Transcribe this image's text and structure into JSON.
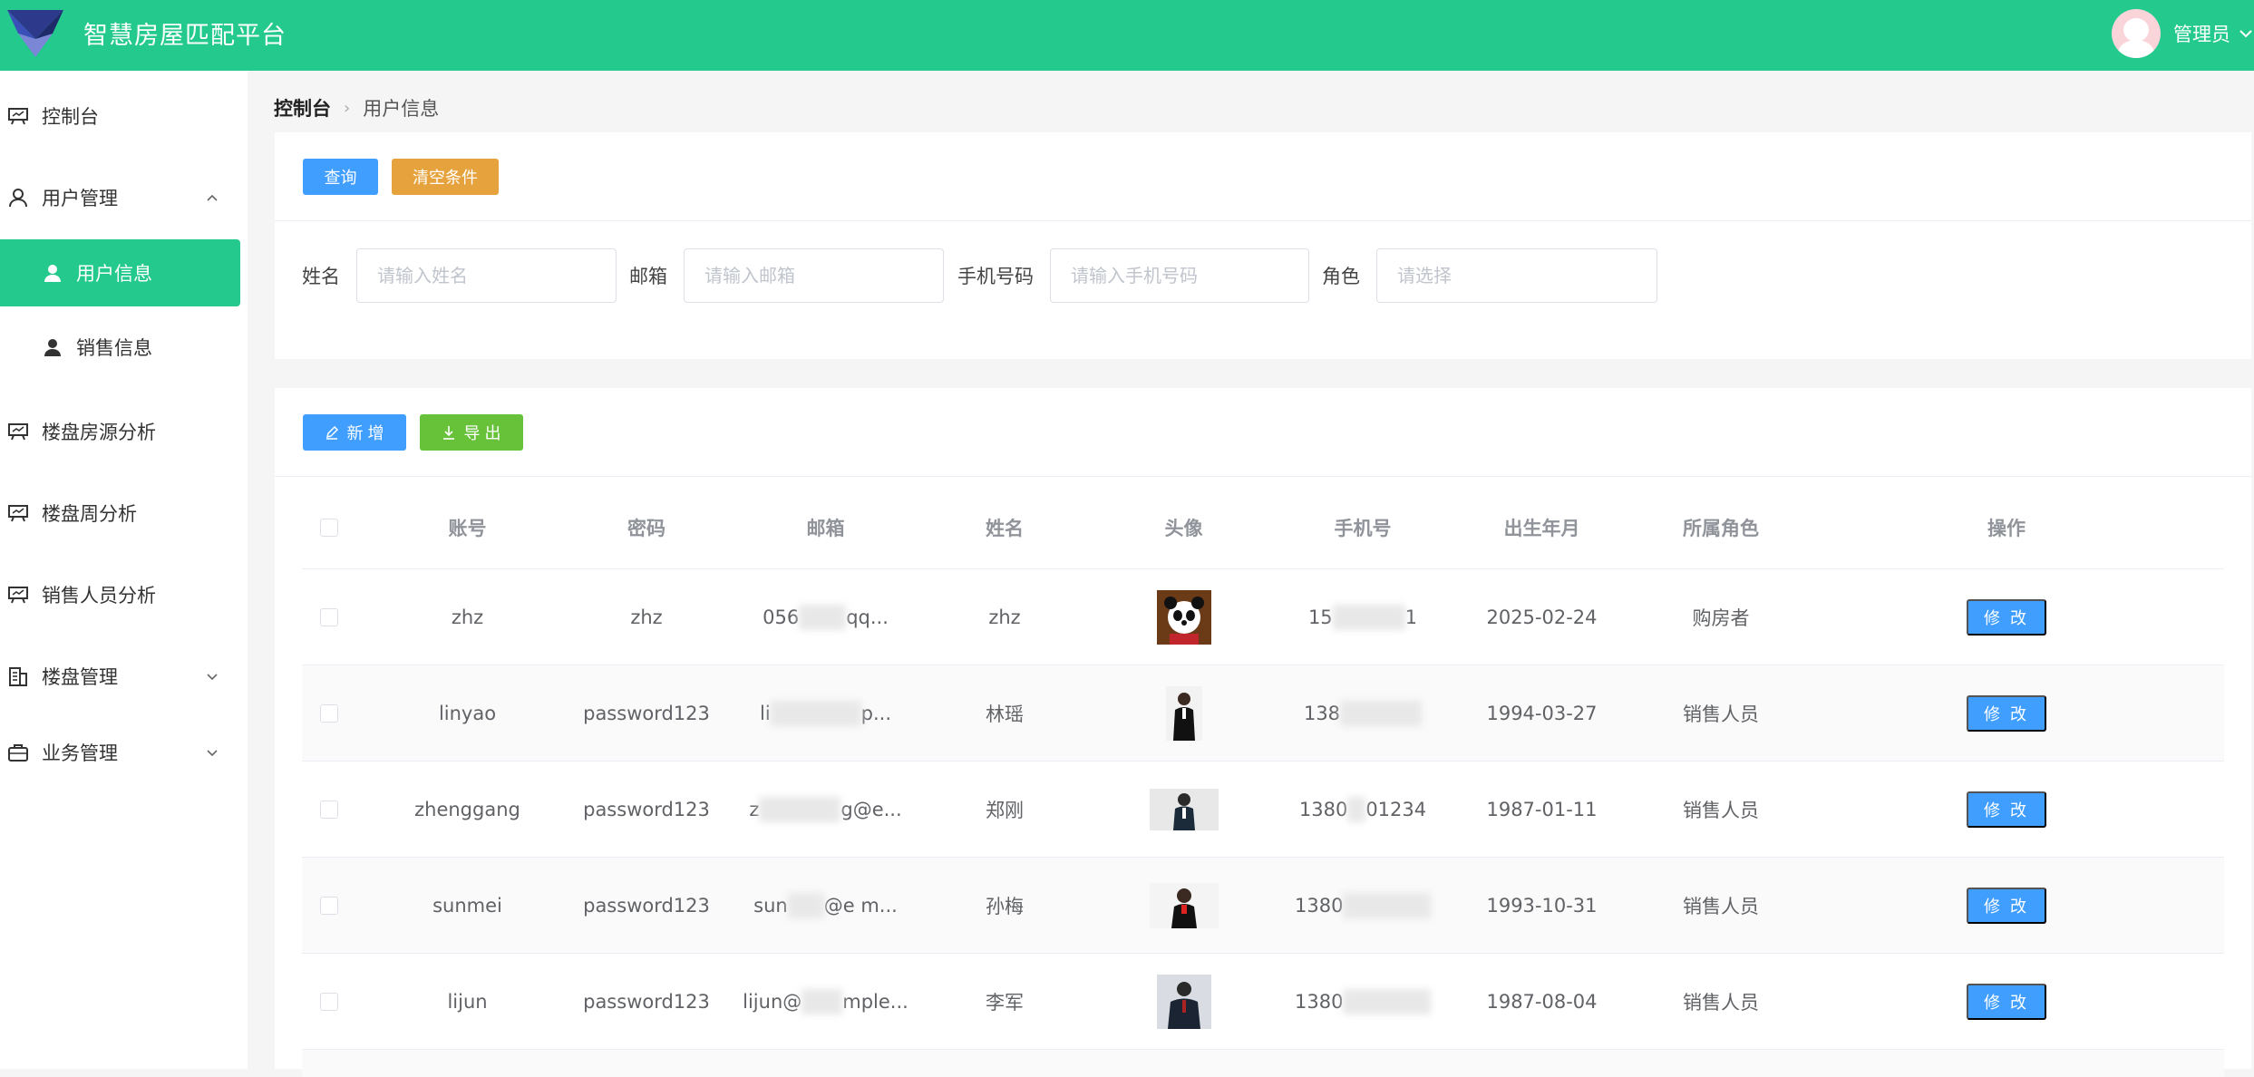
{
  "header": {
    "app_title": "智慧房屋匹配平台",
    "user_name": "管理员",
    "brand_color": "#24c98d"
  },
  "sidebar": {
    "items": [
      {
        "label": "控制台",
        "icon": "presentation-icon"
      },
      {
        "label": "用户管理",
        "icon": "user-outline-icon",
        "expanded": true
      },
      {
        "label": "用户信息",
        "icon": "user-filled-icon",
        "active": true
      },
      {
        "label": "销售信息",
        "icon": "user-filled-icon"
      },
      {
        "label": "楼盘房源分析",
        "icon": "presentation-icon"
      },
      {
        "label": "楼盘周分析",
        "icon": "presentation-icon"
      },
      {
        "label": "销售人员分析",
        "icon": "presentation-icon"
      },
      {
        "label": "楼盘管理",
        "icon": "building-icon",
        "expanded": false
      },
      {
        "label": "业务管理",
        "icon": "briefcase-icon",
        "expanded": false
      }
    ]
  },
  "breadcrumb": {
    "first": "控制台",
    "second": "用户信息"
  },
  "search_panel": {
    "query_label": "查询",
    "clear_label": "清空条件",
    "name_label": "姓名",
    "name_placeholder": "请输入姓名",
    "email_label": "邮箱",
    "email_placeholder": "请输入邮箱",
    "phone_label": "手机号码",
    "phone_placeholder": "请输入手机号码",
    "role_label": "角色",
    "role_placeholder": "请选择"
  },
  "actions": {
    "add_label": "新 增",
    "export_label": "导 出"
  },
  "table": {
    "columns": [
      "账号",
      "密码",
      "邮箱",
      "姓名",
      "头像",
      "手机号",
      "出生年月",
      "所属角色",
      "操作"
    ],
    "edit_label": "修 改",
    "rows": [
      {
        "account": "zhz",
        "password": "zhz",
        "email": "056",
        "email_tail": "qq...",
        "name": "zhz",
        "avatar": "panda-avatar",
        "phone_head": "15",
        "phone_tail": "1",
        "birth": "2025-02-24",
        "role": "购房者"
      },
      {
        "account": "linyao",
        "password": "password123",
        "email": "li",
        "email_tail": "p...",
        "name": "林瑶",
        "avatar": "person-avatar",
        "phone_head": "138",
        "phone_tail": "",
        "birth": "1994-03-27",
        "role": "销售人员"
      },
      {
        "account": "zhenggang",
        "password": "password123",
        "email": "z",
        "email_tail": "g@e...",
        "name": "郑刚",
        "avatar": "person-avatar",
        "phone_head": "1380",
        "phone_tail": "01234",
        "birth": "1987-01-11",
        "role": "销售人员"
      },
      {
        "account": "sunmei",
        "password": "password123",
        "email": "sun",
        "email_tail": "@e m...",
        "name": "孙梅",
        "avatar": "person-avatar",
        "phone_head": "1380",
        "phone_tail": "",
        "birth": "1993-10-31",
        "role": "销售人员"
      },
      {
        "account": "lijun",
        "password": "password123",
        "email": "lijun@",
        "email_tail": "mple...",
        "name": "李军",
        "avatar": "person-avatar",
        "phone_head": "1380",
        "phone_tail": "",
        "birth": "1987-08-04",
        "role": "销售人员"
      }
    ]
  }
}
